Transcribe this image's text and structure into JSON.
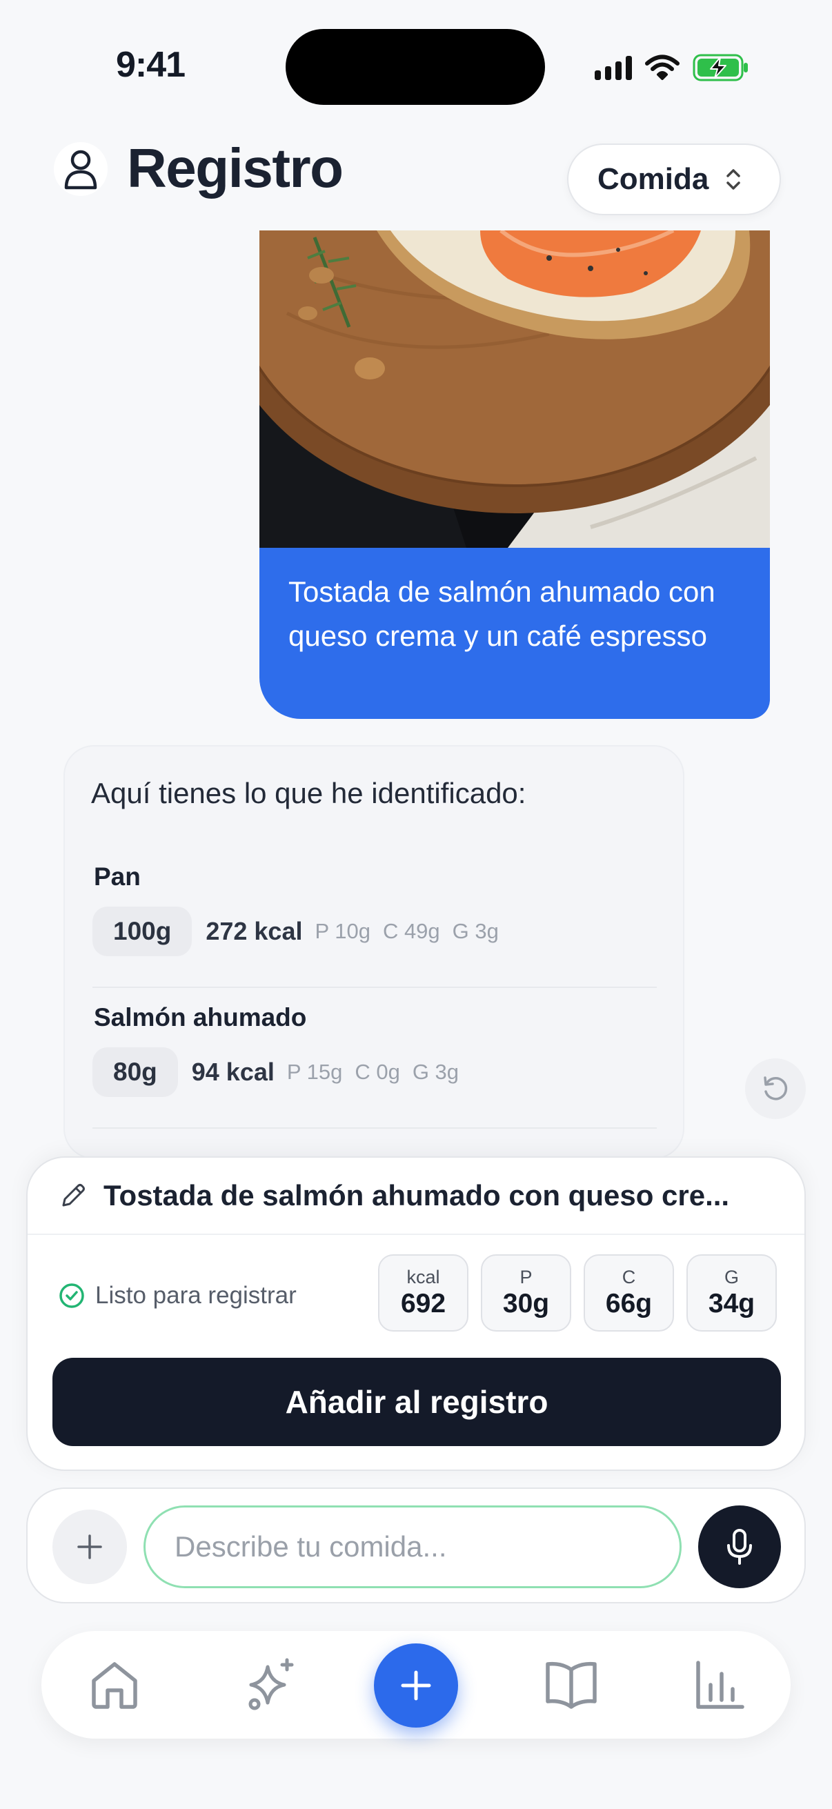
{
  "status_bar": {
    "time": "9:41"
  },
  "header": {
    "title": "Registro",
    "meal_selector": "Comida"
  },
  "user_message": {
    "text": "Tostada de salmón ahumado con queso crema y un café espresso"
  },
  "assistant": {
    "intro": "Aquí tienes lo que he identificado:",
    "items": [
      {
        "name": "Pan",
        "grams": "100g",
        "kcal": "272 kcal",
        "protein": "P 10g",
        "carbs": "C 49g",
        "fat": "G 3g"
      },
      {
        "name": "Salmón ahumado",
        "grams": "80g",
        "kcal": "94 kcal",
        "protein": "P 15g",
        "carbs": "C 0g",
        "fat": "G 3g"
      }
    ]
  },
  "summary": {
    "title": "Tostada de salmón ahumado con queso cre...",
    "status": "Listo para registrar",
    "totals": [
      {
        "label": "kcal",
        "value": "692"
      },
      {
        "label": "P",
        "value": "30g"
      },
      {
        "label": "C",
        "value": "66g"
      },
      {
        "label": "G",
        "value": "34g"
      }
    ],
    "add_button": "Añadir al registro"
  },
  "composer": {
    "placeholder": "Describe tu comida..."
  },
  "colors": {
    "accent": "#2c6aeb",
    "dark": "#141a29",
    "success": "#22b573"
  }
}
